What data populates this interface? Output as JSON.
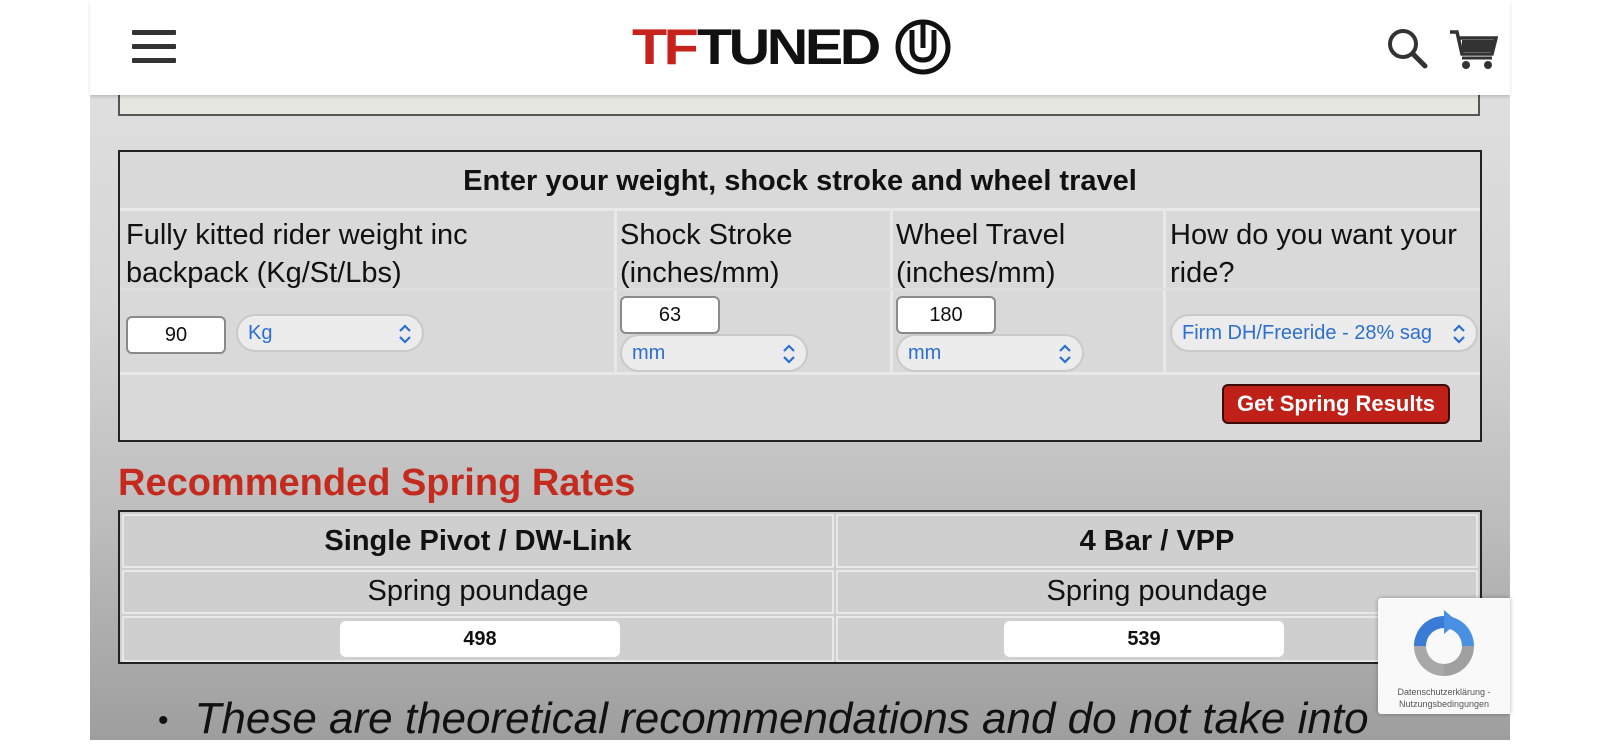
{
  "header": {
    "logo_tf": "TF",
    "logo_tuned": "TUNED",
    "logo_alt": "TFTUNED"
  },
  "calculator": {
    "title": "Enter your weight, shock stroke and wheel travel",
    "weight": {
      "label": "Fully kitted rider weight inc backpack (Kg/St/Lbs)",
      "value": "90",
      "unit": "Kg"
    },
    "stroke": {
      "label": "Shock Stroke (inches/mm)",
      "value": "63",
      "unit": "mm"
    },
    "travel": {
      "label": "Wheel Travel (inches/mm)",
      "value": "180",
      "unit": "mm"
    },
    "ride": {
      "label": "How do you want your ride?",
      "value": "Firm DH/Freeride - 28% sag"
    },
    "submit_label": "Get Spring Results"
  },
  "results": {
    "heading": "Recommended Spring Rates",
    "columns": [
      {
        "title": "Single Pivot / DW-Link",
        "sub": "Spring poundage",
        "value": "498"
      },
      {
        "title": "4 Bar / VPP",
        "sub": "Spring poundage",
        "value": "539"
      }
    ]
  },
  "note": {
    "text": "These are theoretical recommendations and do not take into"
  },
  "recaptcha": {
    "links": "Datenschutzerklärung - Nutzungsbedingungen"
  },
  "colors": {
    "accent_red": "#c42a1e",
    "button_red": "#bf2018",
    "select_text": "#2c6fcf"
  }
}
